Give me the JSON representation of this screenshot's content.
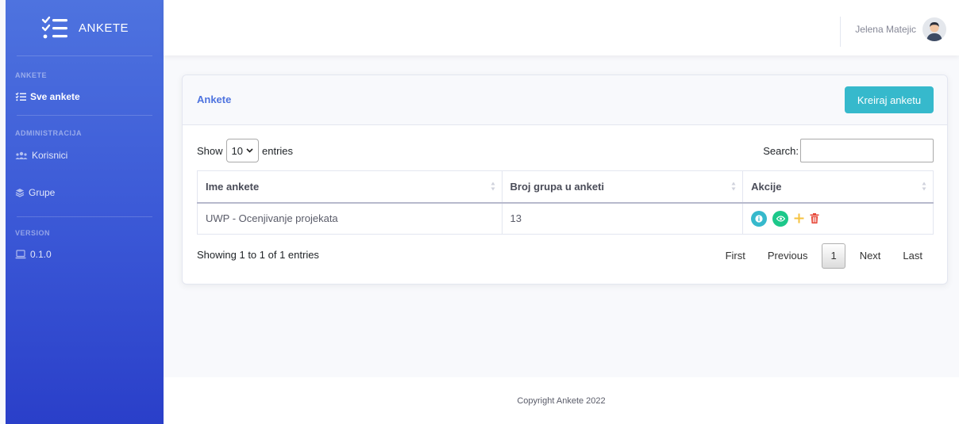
{
  "app": {
    "brand": "ANKETE"
  },
  "sidebar": {
    "sections": [
      {
        "heading": "ANKETE",
        "items": [
          {
            "label": "Sve ankete",
            "icon": "list-icon",
            "active": true
          }
        ]
      },
      {
        "heading": "ADMINISTRACIJA",
        "items": [
          {
            "label": "Korisnici",
            "icon": "users-icon"
          },
          {
            "label": "Grupe",
            "icon": "layers-icon"
          }
        ]
      },
      {
        "heading": "VERSION",
        "items": [
          {
            "label": "0.1.0",
            "icon": "laptop-icon"
          }
        ]
      }
    ]
  },
  "topbar": {
    "user_name": "Jelena Matejic"
  },
  "card": {
    "title": "Ankete",
    "create_label": "Kreiraj anketu",
    "show_label": "Show",
    "entries_value": "10",
    "entries_label": "entries",
    "search_label": "Search:",
    "search_value": "",
    "columns": [
      "Ime ankete",
      "Broj grupa u anketi",
      "Akcije"
    ],
    "rows": [
      {
        "name": "UWP - Ocenjivanje projekata",
        "groups": "13"
      }
    ],
    "info": "Showing 1 to 1 of 1 entries",
    "pager": {
      "first": "First",
      "previous": "Previous",
      "current": "1",
      "next": "Next",
      "last": "Last"
    }
  },
  "footer": {
    "copyright": "Copyright Ankete 2022"
  },
  "colors": {
    "primary": "#4e73df",
    "info": "#36b9cc",
    "success": "#1cc88a",
    "warning": "#f6c23e",
    "danger": "#e74a3b"
  }
}
